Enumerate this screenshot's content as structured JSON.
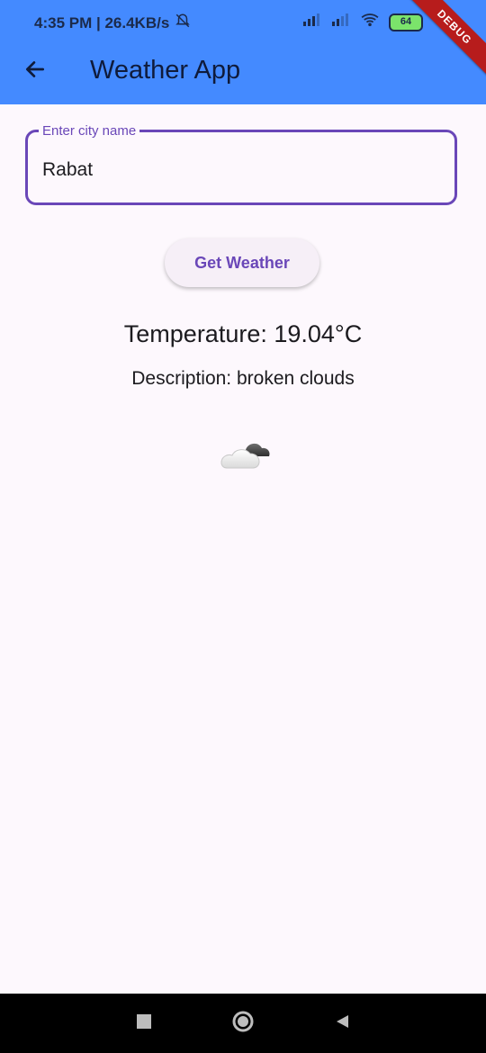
{
  "status_bar": {
    "time_speed": "4:35 PM | 26.4KB/s",
    "battery": "64"
  },
  "debug_banner": "DEBUG",
  "app_bar": {
    "title": "Weather App",
    "back_icon": "arrow-left-icon"
  },
  "city_input": {
    "label": "Enter city name",
    "value": "Rabat"
  },
  "get_weather_button": {
    "label": "Get Weather"
  },
  "result": {
    "temperature": "Temperature: 19.04°C",
    "description": "Description: broken clouds",
    "weather_icon": "broken-clouds-icon"
  },
  "colors": {
    "app_bar": "#448aff",
    "accent": "#6a47b8",
    "background": "#fdf8fd"
  },
  "nav_bar": {
    "recents_icon": "square-icon",
    "home_icon": "circle-icon",
    "back_icon": "triangle-back-icon"
  }
}
